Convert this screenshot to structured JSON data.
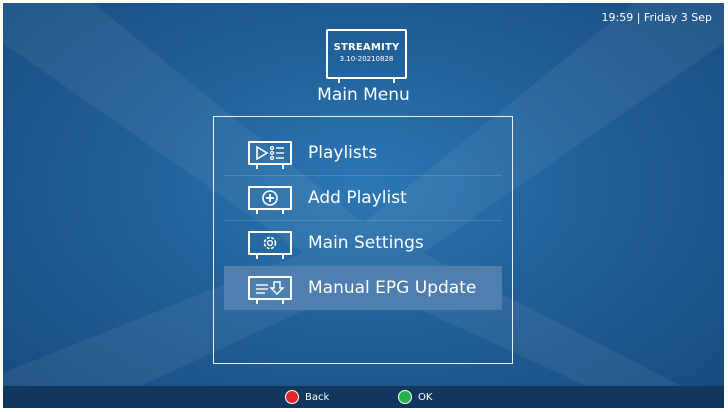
{
  "status": {
    "clock": "19:59 | Friday 3 Sep"
  },
  "logo": {
    "name": "STREAMITY",
    "version": "3.10-20210828"
  },
  "page": {
    "title": "Main Menu"
  },
  "menu": {
    "items": [
      {
        "label": "Playlists",
        "icon": "playlist-icon",
        "selected": false
      },
      {
        "label": "Add Playlist",
        "icon": "add-icon",
        "selected": false
      },
      {
        "label": "Main Settings",
        "icon": "gear-icon",
        "selected": false
      },
      {
        "label": "Manual EPG Update",
        "icon": "download-icon",
        "selected": true
      }
    ]
  },
  "footer": {
    "back_label": "Back",
    "back_color": "#e0282a",
    "ok_label": "OK",
    "ok_color": "#25b24a"
  },
  "colors": {
    "background": "#215f98",
    "selected": "#4f7fae",
    "bottom_bar": "#11375e"
  }
}
